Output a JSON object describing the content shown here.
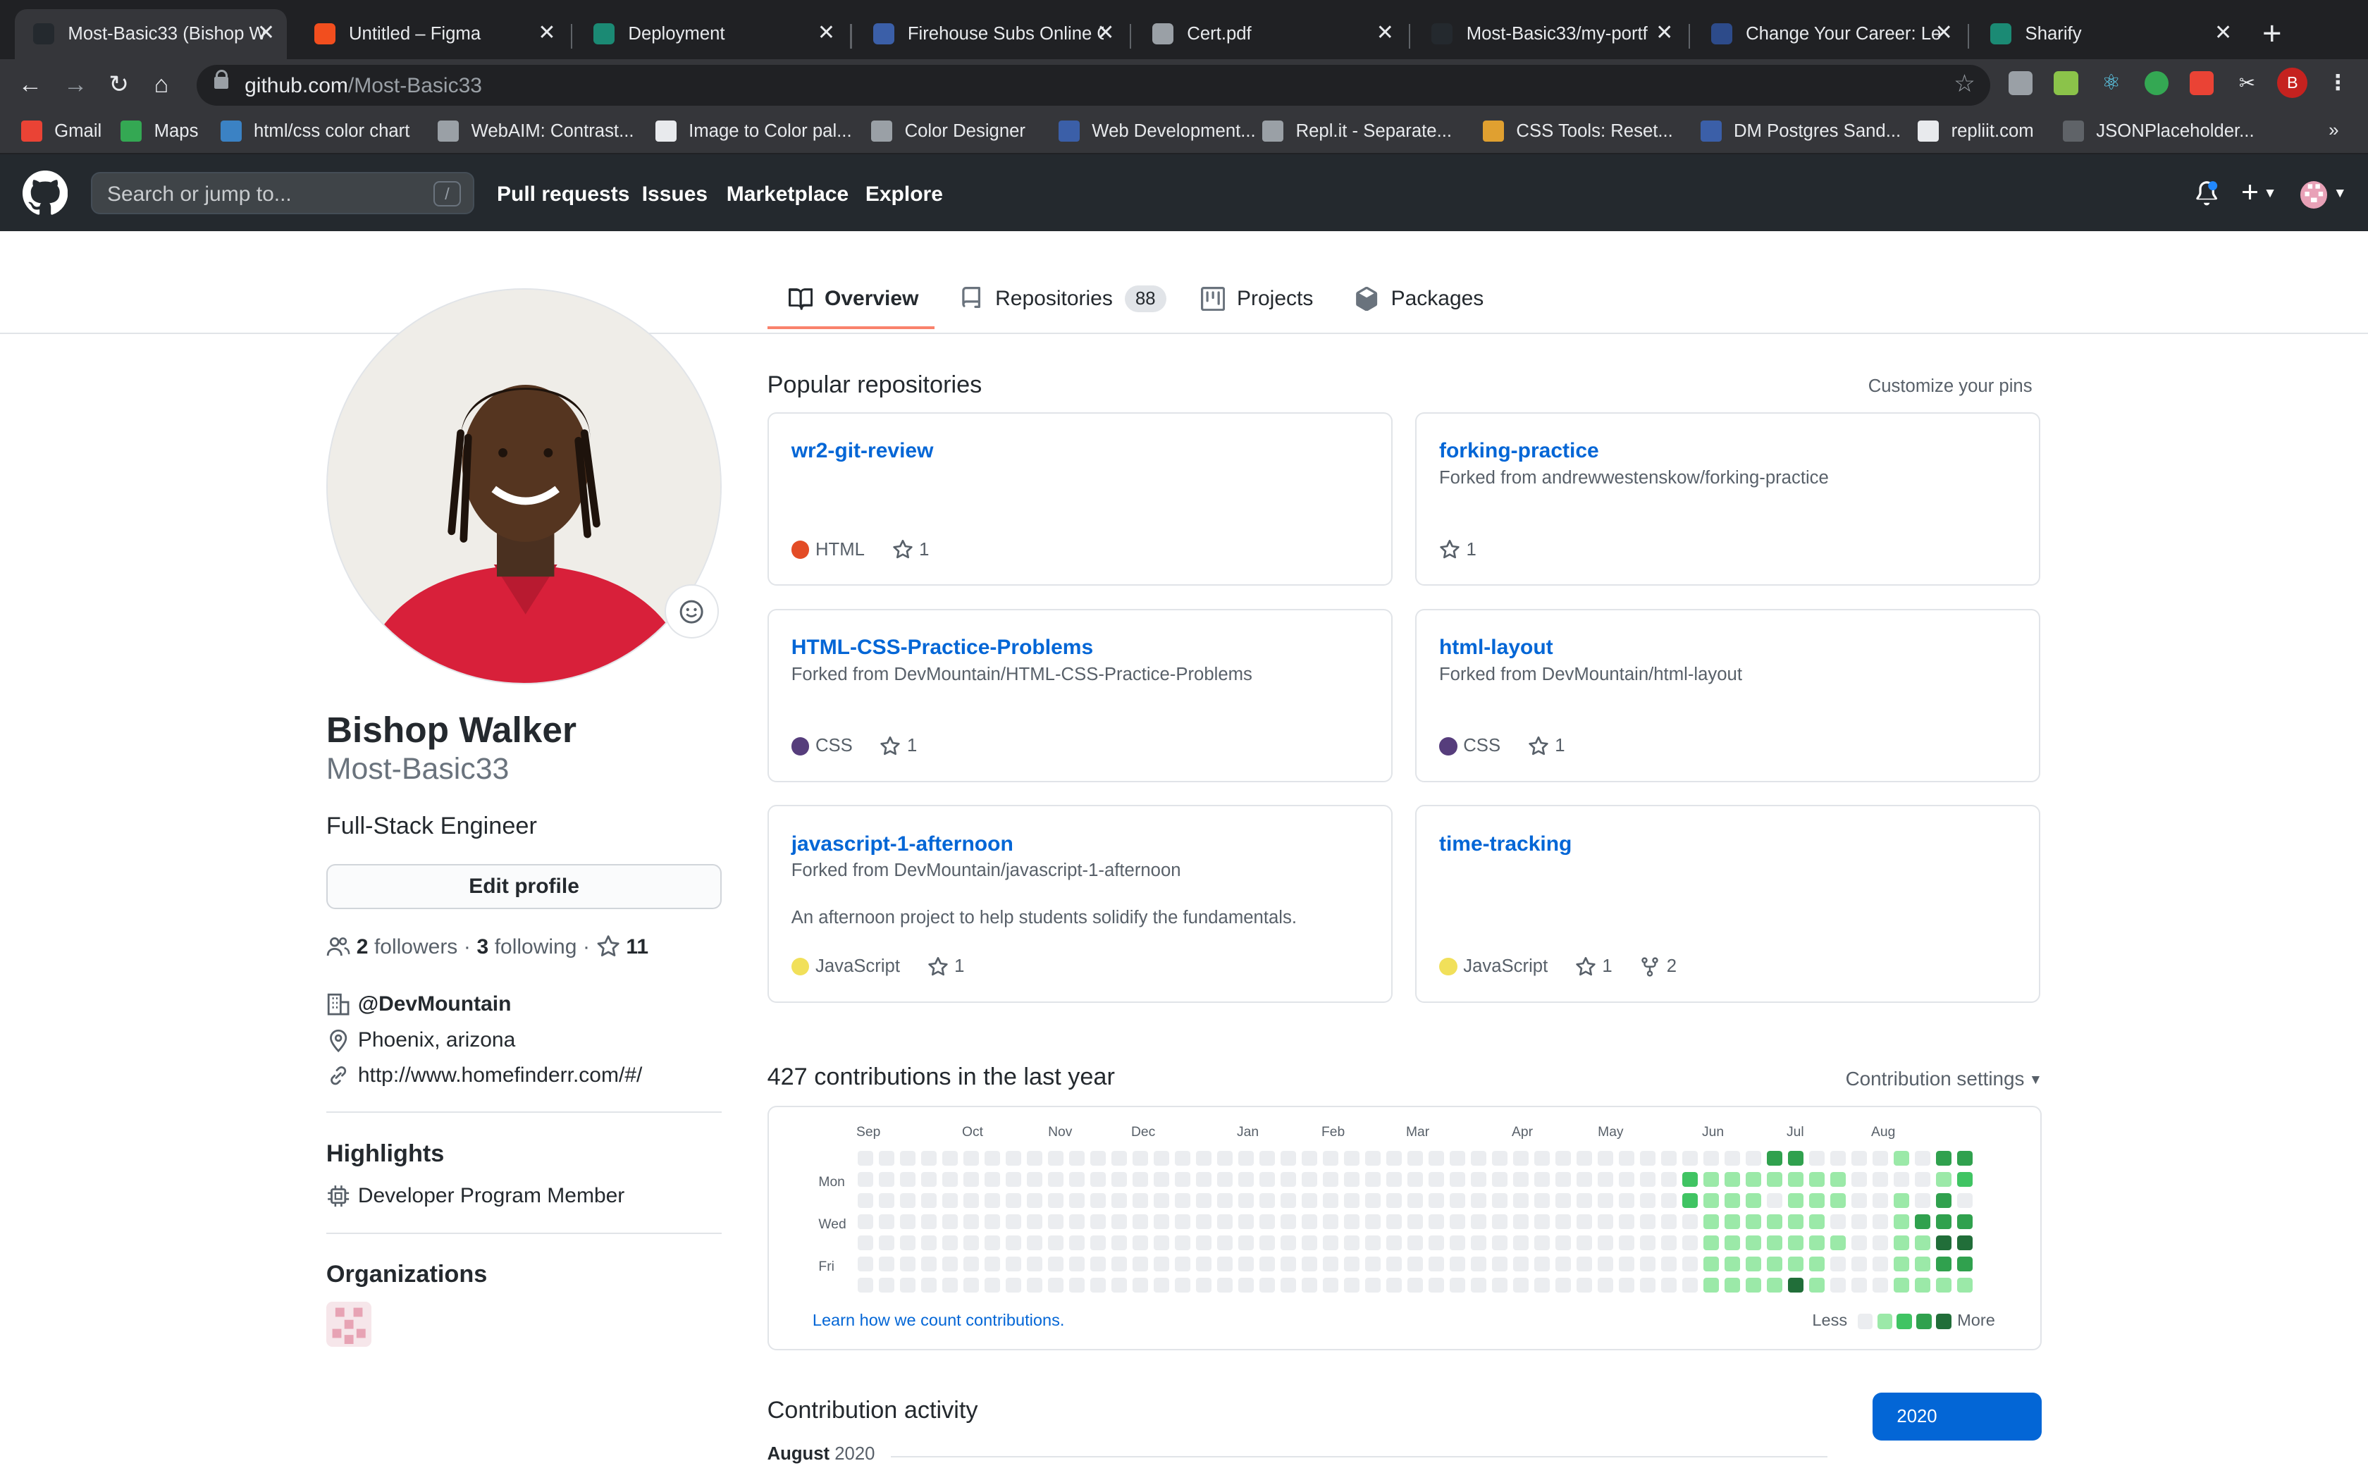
{
  "browser": {
    "tabs": [
      {
        "title": "Most-Basic33 (Bishop W",
        "active": true,
        "favicon": "github-favicon"
      },
      {
        "title": "Untitled – Figma",
        "favicon": "figma-favicon"
      },
      {
        "title": "Deployment",
        "favicon": "react-favicon"
      },
      {
        "title": "Firehouse Subs Online O",
        "favicon": "firehouse-favicon"
      },
      {
        "title": "Cert.pdf",
        "favicon": "globe-favicon"
      },
      {
        "title": "Most-Basic33/my-portf",
        "favicon": "github-favicon"
      },
      {
        "title": "Change Your Career: Le",
        "favicon": "devmountain-favicon"
      },
      {
        "title": "Sharify",
        "favicon": "react-favicon"
      }
    ],
    "url_host": "github.com",
    "url_path": "/Most-Basic33",
    "profile_initial": "B",
    "bookmarks": [
      {
        "label": "Gmail",
        "color": "#ea4335"
      },
      {
        "label": "Maps",
        "color": "#34a853"
      },
      {
        "label": "html/css color chart",
        "color": "#3b82c4"
      },
      {
        "label": "WebAIM: Contrast...",
        "color": "#9aa0a6"
      },
      {
        "label": "Image to Color pal...",
        "color": "#e8eaed"
      },
      {
        "label": "Color Designer",
        "color": "#9aa0a6"
      },
      {
        "label": "Web Development...",
        "color": "#3b5fa8"
      },
      {
        "label": "Repl.it - Separate...",
        "color": "#9aa0a6"
      },
      {
        "label": "CSS Tools: Reset...",
        "color": "#e0a030"
      },
      {
        "label": "DM Postgres Sand...",
        "color": "#3b5fa8"
      },
      {
        "label": "repliit.com",
        "color": "#e8eaed"
      },
      {
        "label": "JSONPlaceholder...",
        "color": "#5f6368"
      }
    ],
    "bookmarks_overflow": "»"
  },
  "gh_header": {
    "search_placeholder": "Search or jump to...",
    "search_key": "/",
    "nav": [
      "Pull requests",
      "Issues",
      "Marketplace",
      "Explore"
    ]
  },
  "profile_tabs": {
    "overview": "Overview",
    "repositories": "Repositories",
    "repositories_count": "88",
    "projects": "Projects",
    "packages": "Packages"
  },
  "profile": {
    "name": "Bishop Walker",
    "login": "Most-Basic33",
    "bio": "Full-Stack Engineer",
    "edit_label": "Edit profile",
    "followers_count": "2",
    "followers_label": "followers",
    "following_count": "3",
    "following_label": "following",
    "stars_count": "11",
    "company": "@DevMountain",
    "location": "Phoenix, arizona",
    "website": "http://www.homefinderr.com/#/",
    "highlights_title": "Highlights",
    "highlight": "Developer Program Member",
    "orgs_title": "Organizations"
  },
  "popular": {
    "title": "Popular repositories",
    "customize": "Customize your pins",
    "repos": [
      {
        "name": "wr2-git-review",
        "fork": "",
        "desc": "",
        "lang": "HTML",
        "lang_color": "#e34c26",
        "stars": "1",
        "forks": ""
      },
      {
        "name": "forking-practice",
        "fork": "Forked from andrewwestenskow/forking-practice",
        "desc": "",
        "lang": "",
        "lang_color": "",
        "stars": "1",
        "forks": ""
      },
      {
        "name": "HTML-CSS-Practice-Problems",
        "fork": "Forked from DevMountain/HTML-CSS-Practice-Problems",
        "desc": "",
        "lang": "CSS",
        "lang_color": "#563d7c",
        "stars": "1",
        "forks": ""
      },
      {
        "name": "html-layout",
        "fork": "Forked from DevMountain/html-layout",
        "desc": "",
        "lang": "CSS",
        "lang_color": "#563d7c",
        "stars": "1",
        "forks": ""
      },
      {
        "name": "javascript-1-afternoon",
        "fork": "Forked from DevMountain/javascript-1-afternoon",
        "desc": "An afternoon project to help students solidify the fundamentals.",
        "lang": "JavaScript",
        "lang_color": "#f1e05a",
        "stars": "1",
        "forks": ""
      },
      {
        "name": "time-tracking",
        "fork": "",
        "desc": "",
        "lang": "JavaScript",
        "lang_color": "#f1e05a",
        "stars": "1",
        "forks": "2"
      }
    ]
  },
  "contrib": {
    "title": "427 contributions in the last year",
    "settings": "Contribution settings",
    "months": [
      "Sep",
      "Oct",
      "Nov",
      "Dec",
      "Jan",
      "Feb",
      "Mar",
      "Apr",
      "May",
      "Jun",
      "Jul",
      "Aug"
    ],
    "days": [
      "Mon",
      "Wed",
      "Fri"
    ],
    "learn": "Learn how we count contributions.",
    "less": "Less",
    "more": "More",
    "colors": [
      "#ebedf0",
      "#9be9a8",
      "#40c463",
      "#30a14e",
      "#216e39"
    ],
    "active_weeks": [
      [
        0,
        2,
        2,
        0,
        0,
        0,
        0
      ],
      [
        0,
        1,
        1,
        1,
        1,
        1,
        1
      ],
      [
        0,
        1,
        1,
        1,
        1,
        1,
        1
      ],
      [
        0,
        1,
        1,
        1,
        1,
        1,
        1
      ],
      [
        3,
        1,
        0,
        1,
        1,
        1,
        1
      ],
      [
        3,
        1,
        1,
        1,
        1,
        1,
        4
      ],
      [
        0,
        1,
        1,
        1,
        1,
        1,
        1
      ],
      [
        0,
        1,
        1,
        0,
        1,
        0,
        0
      ],
      [
        0,
        0,
        0,
        0,
        0,
        0,
        0
      ],
      [
        0,
        0,
        0,
        0,
        0,
        0,
        0
      ],
      [
        1,
        0,
        1,
        1,
        1,
        1,
        1
      ],
      [
        0,
        0,
        0,
        3,
        1,
        1,
        1
      ],
      [
        3,
        1,
        3,
        3,
        4,
        3,
        1
      ],
      [
        3,
        2,
        0,
        3,
        4,
        3,
        1
      ]
    ]
  },
  "activity": {
    "title": "Contribution activity",
    "year": "2020",
    "month": "August",
    "month_year": "2020"
  }
}
